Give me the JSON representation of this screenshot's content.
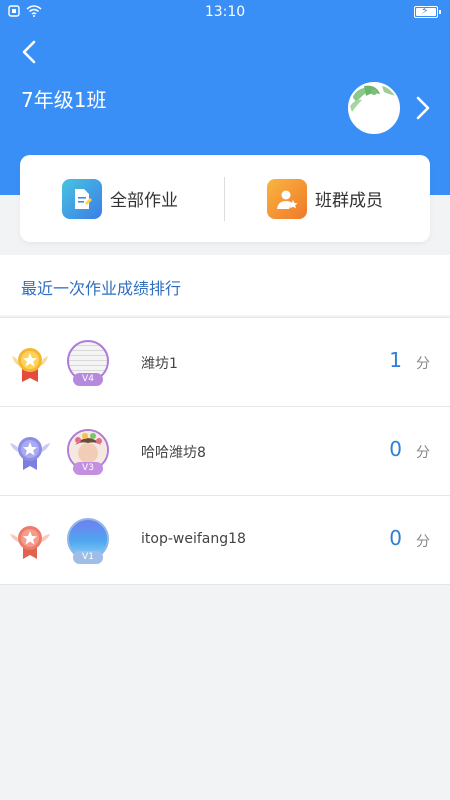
{
  "status_bar": {
    "time": "13:10"
  },
  "header": {
    "title": "7年级1班"
  },
  "actions": [
    {
      "label": "全部作业",
      "icon": "homework-doc-icon",
      "color": "#3b9de8"
    },
    {
      "label": "班群成员",
      "icon": "group-members-icon",
      "color": "#f39a2b"
    }
  ],
  "section": {
    "title": "最近一次作业成绩排行"
  },
  "ranking": [
    {
      "name": "潍坊1",
      "score": "1",
      "unit": "分",
      "level": "V4",
      "medal": "gold"
    },
    {
      "name": "哈哈潍坊8",
      "score": "0",
      "unit": "分",
      "level": "V3",
      "medal": "silver"
    },
    {
      "name": "itop-weifang18",
      "score": "0",
      "unit": "分",
      "level": "V1",
      "medal": "bronze"
    }
  ],
  "colors": {
    "header": "#3a8ff7",
    "accent": "#2f7fd6",
    "gold": "#f3b733",
    "silver": "#8b8de6",
    "bronze": "#ee7a68"
  }
}
